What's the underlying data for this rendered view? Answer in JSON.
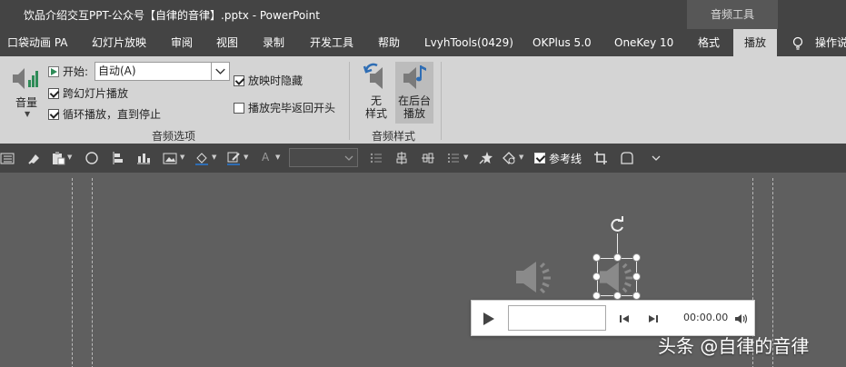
{
  "window": {
    "title": "饮品介绍交互PPT-公众号【自律的音律】.pptx  -  PowerPoint",
    "context_tool": "音频工具"
  },
  "tabs": [
    {
      "label": "口袋动画 PA"
    },
    {
      "label": "幻灯片放映"
    },
    {
      "label": "审阅"
    },
    {
      "label": "视图"
    },
    {
      "label": "录制"
    },
    {
      "label": "开发工具"
    },
    {
      "label": "帮助"
    },
    {
      "label": "LvyhTools(0429)"
    },
    {
      "label": "OKPlus 5.0"
    },
    {
      "label": "OneKey 10"
    },
    {
      "label": "格式"
    },
    {
      "label": "播放",
      "active": true
    }
  ],
  "tell_me": "操作说",
  "ribbon": {
    "volume_label": "音量",
    "start_label": "开始:",
    "start_value": "自动(A)",
    "cross_slides": {
      "label": "跨幻灯片播放",
      "checked": true
    },
    "loop": {
      "label": "循环播放，直到停止",
      "checked": true
    },
    "hide_during_show": {
      "label": "放映时隐藏",
      "checked": true
    },
    "rewind_after": {
      "label": "播放完毕返回开头",
      "checked": false
    },
    "group_audio_options": "音频选项",
    "style_none": {
      "line1": "无",
      "line2": "样式"
    },
    "style_background": {
      "line1": "在后台",
      "line2": "播放"
    },
    "group_audio_styles": "音频样式"
  },
  "toolbar2": {
    "guides_label": "参考线",
    "guides_checked": true
  },
  "player": {
    "time": "00:00.00"
  },
  "watermark": "头条 @自律的音律",
  "colors": {
    "title_bg": "#444444",
    "ribbon_bg": "#d4d4d4",
    "canvas_bg": "#5f5f5f",
    "icon_gray": "#8a8a8a",
    "accent_blue": "#2e6db4",
    "accent_green": "#2e8b57"
  }
}
